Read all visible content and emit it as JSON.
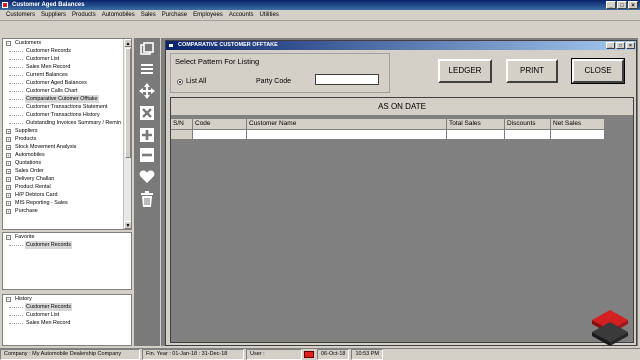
{
  "app": {
    "title": "Customer Aged Balances",
    "window_buttons": [
      "_",
      "□",
      "×"
    ]
  },
  "menu": [
    "Customers",
    "Suppliers",
    "Products",
    "Automobiles",
    "Sales",
    "Purchase",
    "Employees",
    "Accounts",
    "Utilities"
  ],
  "tree": {
    "main": [
      {
        "type": "root",
        "sign": "−",
        "label": "Customers"
      },
      {
        "type": "child",
        "label": "Customer Records"
      },
      {
        "type": "child",
        "label": "Customer List"
      },
      {
        "type": "child",
        "label": "Sales Men Record"
      },
      {
        "type": "child",
        "label": "Current Balances"
      },
      {
        "type": "child",
        "label": "Customer Aged Balances"
      },
      {
        "type": "child",
        "label": "Customer Calls Chart"
      },
      {
        "type": "child",
        "label": "Comparative Cutomer Offtake",
        "selected": true
      },
      {
        "type": "child",
        "label": "Customer Transactions Statement"
      },
      {
        "type": "child",
        "label": "Customer Transactions History"
      },
      {
        "type": "child",
        "label": "Outstanding Invoices Summary / Remin"
      },
      {
        "type": "root",
        "sign": "+",
        "label": "Suppliers"
      },
      {
        "type": "root",
        "sign": "+",
        "label": "Products"
      },
      {
        "type": "root",
        "sign": "+",
        "label": "Stock Movement Analysis"
      },
      {
        "type": "root",
        "sign": "+",
        "label": "Automobiles"
      },
      {
        "type": "root",
        "sign": "+",
        "label": "Quotations"
      },
      {
        "type": "root",
        "sign": "+",
        "label": "Sales Order"
      },
      {
        "type": "root",
        "sign": "+",
        "label": "Delivery Challan"
      },
      {
        "type": "root",
        "sign": "+",
        "label": "Product Rental"
      },
      {
        "type": "root",
        "sign": "+",
        "label": "H/P Debtors Card"
      },
      {
        "type": "root",
        "sign": "+",
        "label": "MIS Reporting - Sales"
      },
      {
        "type": "root",
        "sign": "+",
        "label": "Purchase"
      }
    ],
    "favorite": [
      {
        "type": "root",
        "sign": "−",
        "label": "Favorite"
      },
      {
        "type": "child",
        "label": "Customer Records",
        "selected": true
      }
    ],
    "history": [
      {
        "type": "root",
        "sign": "−",
        "label": "History"
      },
      {
        "type": "child",
        "label": "Customer Records",
        "selected": true
      },
      {
        "type": "child",
        "label": "Customer List"
      },
      {
        "type": "child",
        "label": "Sales Men Record"
      }
    ]
  },
  "toolbar_icons": [
    "windows-icon",
    "menu-lines-icon",
    "move-arrows-icon",
    "delete-x-icon",
    "add-plus-icon",
    "minus-icon",
    "heart-icon",
    "trash-icon"
  ],
  "child_window": {
    "title": "COMPARATIVE CUSTOMER OFFTAKE",
    "buttons": [
      "_",
      "□",
      "×"
    ],
    "pattern_title": "Select Pattern For Listing",
    "list_all": "List All",
    "party_code_label": "Party Code",
    "party_code_value": "",
    "ledger": "LEDGER",
    "print": "PRINT",
    "close": "CLOSE",
    "as_on_date": "AS ON DATE"
  },
  "grid": {
    "columns": [
      "S/N",
      "Code",
      "Customer Name",
      "Total Sales",
      "Discounts",
      "Net Sales"
    ]
  },
  "status": {
    "company": "Company : My Automobile Dealership Company",
    "fin_year": "Fin. Year : 01-Jan-18 : 31-Dec-18",
    "user": "User :",
    "date": "06-Oct-18",
    "time": "10:53 PM"
  },
  "colors": {
    "title_bar": "#0a246a",
    "panel": "#d4d0c8",
    "mdi_background": "#7f7f7f",
    "status_indicator": "#e02020"
  }
}
